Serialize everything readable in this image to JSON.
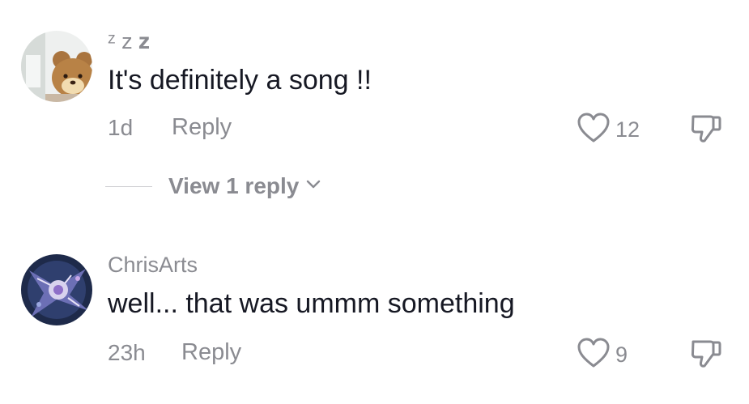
{
  "comments": [
    {
      "username": "ᶻ z 𝐳",
      "text": "It's definitely a song !!",
      "time": "1d",
      "reply_label": "Reply",
      "likes": "12",
      "view_replies_label": "View 1 reply"
    },
    {
      "username": "ChrisArts",
      "text": "well... that was ummm something",
      "time": "23h",
      "reply_label": "Reply",
      "likes": "9"
    }
  ],
  "icons": {
    "like": "heart-outline-icon",
    "dislike": "thumbs-down-icon",
    "expand": "chevron-down-icon"
  },
  "colors": {
    "text_primary": "#161823",
    "text_secondary": "#8a8b91"
  }
}
